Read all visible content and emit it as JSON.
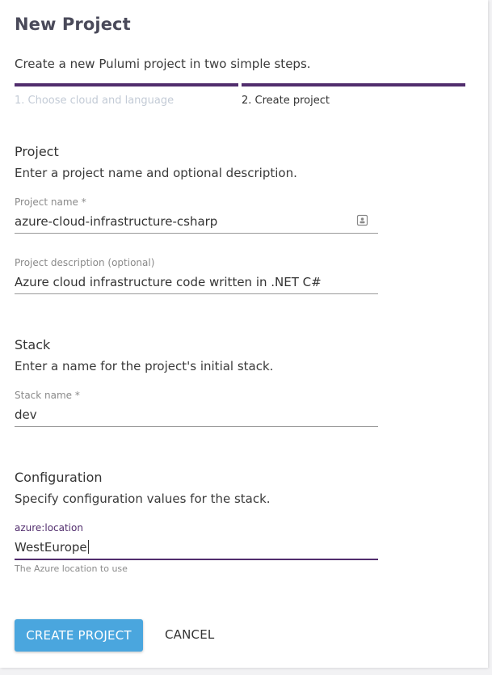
{
  "header": {
    "title": "New Project",
    "subtitle": "Create a new Pulumi project in two simple steps."
  },
  "steps": [
    {
      "label": "1. Choose cloud and language",
      "state": "inactive"
    },
    {
      "label": "2. Create project",
      "state": "active"
    }
  ],
  "project": {
    "heading": "Project",
    "description": "Enter a project name and optional description.",
    "name_label": "Project name *",
    "name_value": "azure-cloud-infrastructure-csharp",
    "name_icon": "contact-card-icon",
    "desc_label": "Project description (optional)",
    "desc_value": "Azure cloud infrastructure code written in .NET C#"
  },
  "stack": {
    "heading": "Stack",
    "description": "Enter a name for the project's initial stack.",
    "name_label": "Stack name *",
    "name_value": "dev"
  },
  "configuration": {
    "heading": "Configuration",
    "description": "Specify configuration values for the stack.",
    "key_label": "azure:location",
    "value": "WestEurope",
    "helper": "The Azure location to use"
  },
  "actions": {
    "create_label": "CREATE PROJECT",
    "cancel_label": "CANCEL"
  },
  "colors": {
    "accent": "#512d6d",
    "primary_button": "#4aa6de",
    "inactive_step": "#c3cbd6"
  }
}
